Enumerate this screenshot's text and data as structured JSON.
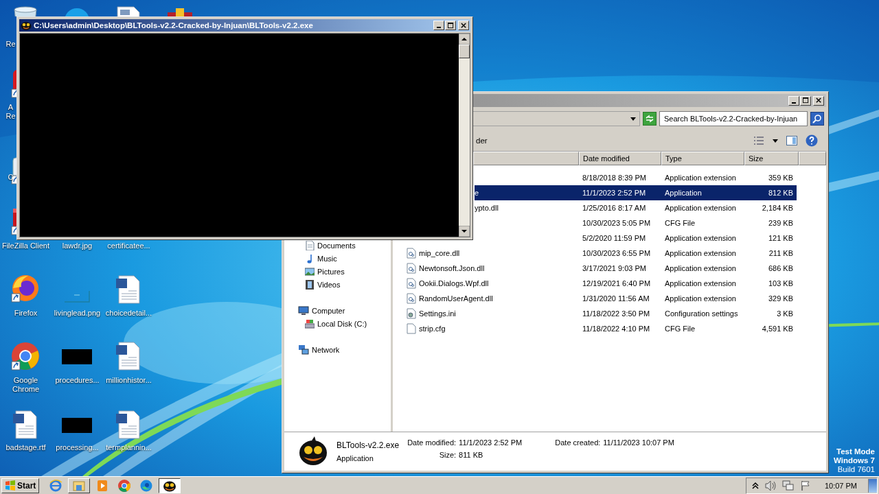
{
  "desktop": {
    "icons": [
      {
        "kind": "recycle",
        "label": "Re"
      },
      {
        "kind": "pdf",
        "shortcut": true,
        "label": "A Re"
      },
      {
        "kind": "app",
        "shortcut": true,
        "label": "C"
      },
      {
        "kind": "filezilla",
        "shortcut": true,
        "label": "FileZilla Client"
      },
      {
        "kind": "firefox",
        "shortcut": true,
        "label": "Firefox"
      },
      {
        "kind": "chrome",
        "shortcut": true,
        "label": "Google Chrome"
      },
      {
        "kind": "word",
        "label": "badstage.rtf"
      },
      {
        "kind": "skype"
      },
      {
        "label": "lawdr.jpg"
      },
      {
        "kind": "image-frame",
        "label": "livinglead.png"
      },
      {
        "kind": "thumbnail",
        "label": "procedures..."
      },
      {
        "kind": "thumbnail",
        "label": "processing..."
      },
      {
        "kind": "document"
      },
      {
        "label": "certificatee..."
      },
      {
        "kind": "word",
        "label": "choicedetail..."
      },
      {
        "kind": "word",
        "label": "millionhistor..."
      },
      {
        "kind": "word",
        "label": "termplannin..."
      },
      {
        "kind": "archive"
      }
    ]
  },
  "console_window": {
    "title": "C:\\Users\\admin\\Desktop\\BLTools-v2.2-Cracked-by-Injuan\\BLTools-v2.2.exe"
  },
  "explorer": {
    "search": {
      "placeholder": "Search BLTools-v2.2-Cracked-by-Injuan"
    },
    "toolbar": {
      "label": "der"
    },
    "nav": [
      {
        "children": [
          {
            "kind": "documents",
            "label": "Documents"
          },
          {
            "kind": "music",
            "label": "Music"
          },
          {
            "kind": "pictures",
            "label": "Pictures"
          },
          {
            "kind": "videos",
            "label": "Videos"
          }
        ]
      },
      {
        "kind": "computer",
        "label": "Computer",
        "children": [
          {
            "kind": "disk",
            "label": "Local Disk (C:)"
          }
        ]
      },
      {
        "kind": "network",
        "label": "Network"
      }
    ],
    "columns": [
      "Date modified",
      "Type",
      "Size"
    ],
    "files": [
      {
        "date": "8/18/2018 8:39 PM",
        "type": "Application extension",
        "size": "359 KB",
        "selected": false
      },
      {
        "name": "e",
        "date": "11/1/2023 2:52 PM",
        "type": "Application",
        "size": "812 KB",
        "selected": true
      },
      {
        "name": "ypto.dll",
        "date": "1/25/2016 8:17 AM",
        "type": "Application extension",
        "size": "2,184 KB",
        "selected": false
      },
      {
        "date": "10/30/2023 5:05 PM",
        "type": "CFG File",
        "size": "239 KB",
        "selected": false
      },
      {
        "date": "5/2/2020 11:59 PM",
        "type": "Application extension",
        "size": "121 KB",
        "selected": false
      },
      {
        "kind": "dll",
        "name": "mip_core.dll",
        "date": "10/30/2023 6:55 PM",
        "type": "Application extension",
        "size": "211 KB",
        "selected": false
      },
      {
        "kind": "dll",
        "name": "Newtonsoft.Json.dll",
        "date": "3/17/2021 9:03 PM",
        "type": "Application extension",
        "size": "686 KB",
        "selected": false
      },
      {
        "kind": "dll",
        "name": "Ookii.Dialogs.Wpf.dll",
        "date": "12/19/2021 6:40 PM",
        "type": "Application extension",
        "size": "103 KB",
        "selected": false
      },
      {
        "kind": "dll",
        "name": "RandomUserAgent.dll",
        "date": "1/31/2020 11:56 AM",
        "type": "Application extension",
        "size": "329 KB",
        "selected": false
      },
      {
        "kind": "ini",
        "name": "Settings.ini",
        "date": "11/18/2022 3:50 PM",
        "type": "Configuration settings",
        "size": "3 KB",
        "selected": false
      },
      {
        "kind": "cfg",
        "name": "strip.cfg",
        "date": "11/18/2022 4:10 PM",
        "type": "CFG File",
        "size": "4,591 KB",
        "selected": false
      }
    ],
    "details": {
      "name": "BLTools-v2.2.exe",
      "type": "Application",
      "modified_label": "Date modified:",
      "modified": "11/1/2023 2:52 PM",
      "size_label": "Size:",
      "size": "811 KB",
      "created_label": "Date created:",
      "created": "11/11/2023 10:07 PM"
    }
  },
  "os_watermark": [
    "Test Mode",
    "Windows 7",
    "Build 7601"
  ],
  "taskbar": {
    "start": "Start",
    "apps": [
      {
        "kind": "ie",
        "running": false,
        "selected": false
      },
      {
        "kind": "explorer",
        "running": true,
        "selected": false
      },
      {
        "kind": "media",
        "running": false,
        "selected": false
      },
      {
        "kind": "chrome",
        "running": false,
        "selected": false
      },
      {
        "kind": "edge",
        "running": false,
        "selected": false
      },
      {
        "kind": "bltools",
        "running": true,
        "selected": true
      }
    ],
    "clock": "10:07 PM"
  }
}
